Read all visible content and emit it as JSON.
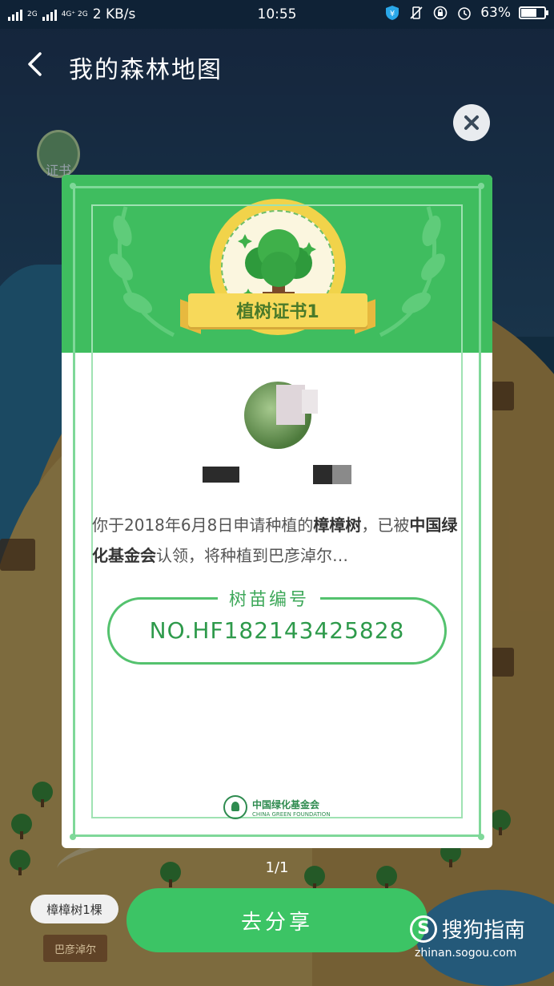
{
  "status_bar": {
    "network_1": "2G",
    "network_2": "4G⁺ 2G",
    "speed": "2 KB/s",
    "time": "10:55",
    "battery": "63%",
    "battery_level": 0.63
  },
  "header": {
    "title": "我的森林地图"
  },
  "side_button": {
    "label": "证书"
  },
  "certificate": {
    "ribbon_title": "植树证书1",
    "description_prefix": "你于2018年6月8日申请种植的",
    "tree_name": "樟樟树",
    "description_mid": "，已被",
    "organization": "中国绿化基金会",
    "description_suffix": "认领，将种植到巴彦淖尔…",
    "serial_label": "树苗编号",
    "serial_value": "NO.HF182143425828",
    "foundation_cn": "中国绿化基金会",
    "foundation_en": "CHINA GREEN FOUNDATION"
  },
  "pager": "1/1",
  "share_button": "去分享",
  "map_tags": {
    "tree_count": "樟樟树1棵",
    "location_sign": "巴彦淖尔"
  },
  "watermark": {
    "cn": "搜狗指南",
    "en": "zhinan.sogou.com"
  },
  "colors": {
    "primary_green": "#3fbd5f",
    "serial_green": "#2e9a4b",
    "seal_yellow": "#f1d34a"
  }
}
